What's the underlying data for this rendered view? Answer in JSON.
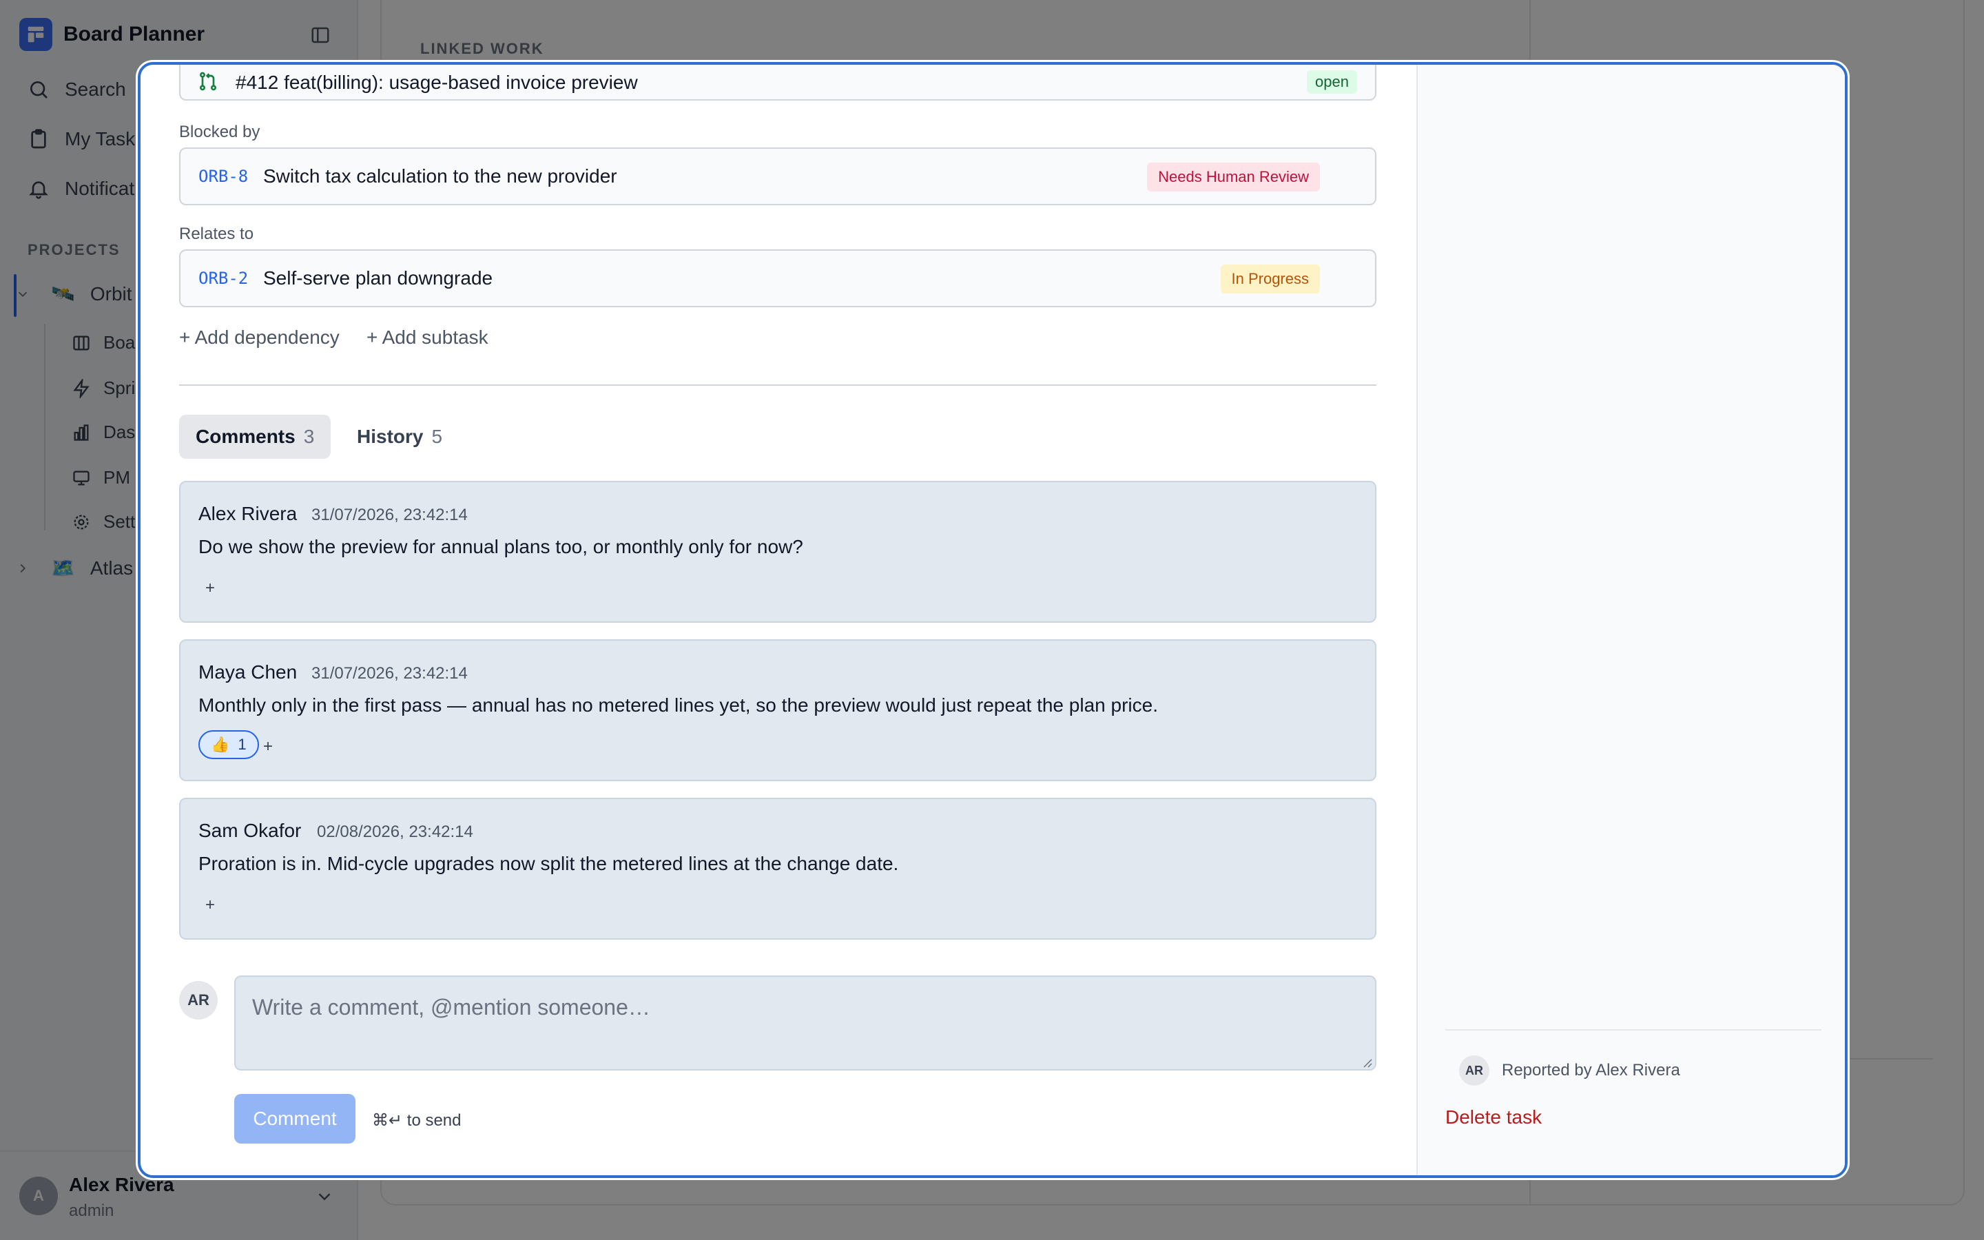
{
  "app": {
    "title": "Board Planner",
    "nav": [
      {
        "label": "Search",
        "icon": "search-icon"
      },
      {
        "label": "My Tasks",
        "icon": "clipboard-icon"
      },
      {
        "label": "Notifications",
        "icon": "bell-icon"
      }
    ],
    "projects_label": "PROJECTS",
    "projects": [
      {
        "label": "Orbit",
        "emoji": "🛰️",
        "expanded": true
      },
      {
        "label": "Atlas",
        "emoji": "🗺️",
        "expanded": false
      }
    ],
    "orbit_items": [
      {
        "label": "Board",
        "icon": "board-icon"
      },
      {
        "label": "Sprints",
        "icon": "lightning-icon"
      },
      {
        "label": "Dashboard",
        "icon": "bar-chart-icon"
      },
      {
        "label": "PM agent",
        "icon": "monitor-icon"
      },
      {
        "label": "Settings",
        "icon": "gear-icon"
      }
    ],
    "user": {
      "initial": "A",
      "name": "Alex Rivera",
      "role": "admin"
    },
    "linked_work_label": "LINKED WORK"
  },
  "modal": {
    "pr": {
      "title": "#412 feat(billing): usage-based invoice preview",
      "status": "open"
    },
    "blocked_by_label": "Blocked by",
    "blocked_by": {
      "key": "ORB-8",
      "title": "Switch tax calculation to the new provider",
      "status": "Needs Human Review"
    },
    "relates_to_label": "Relates to",
    "relates_to": {
      "key": "ORB-2",
      "title": "Self-serve plan downgrade",
      "status": "In Progress"
    },
    "add_dependency": "+ Add dependency",
    "add_subtask": "+ Add subtask",
    "tabs": [
      {
        "label": "Comments",
        "count": "3",
        "active": true
      },
      {
        "label": "History",
        "count": "5",
        "active": false
      }
    ],
    "comments": [
      {
        "author": "Alex Rivera",
        "timestamp": "31/07/2026, 23:42:14",
        "body": "Do we show the preview for annual plans too, or monthly only for now?"
      },
      {
        "author": "Maya Chen",
        "timestamp": "31/07/2026, 23:42:14",
        "body": "Monthly only in the first pass — annual has no metered lines yet, so the preview would just repeat the plan price.",
        "reaction": {
          "emoji": "👍",
          "count": "1"
        }
      },
      {
        "author": "Sam Okafor",
        "timestamp": "02/08/2026, 23:42:14",
        "body": "Proration is in. Mid-cycle upgrades now split the metered lines at the change date."
      }
    ],
    "add_reaction": "+",
    "composer": {
      "avatar": "AR",
      "placeholder": "Write a comment, @mention someone…",
      "submit": "Comment",
      "hint": "⌘↵ to send"
    },
    "sidebar": {
      "reporter_avatar": "AR",
      "reported_by": "Reported by Alex Rivera",
      "delete_task": "Delete task"
    }
  },
  "colors": {
    "accent": "#2563eb",
    "modal_border": "#2f6fd0",
    "danger": "#b91c1c",
    "badge_open": "#dcfce7",
    "badge_review": "#fde2e7",
    "badge_progress": "#fef3c7"
  }
}
